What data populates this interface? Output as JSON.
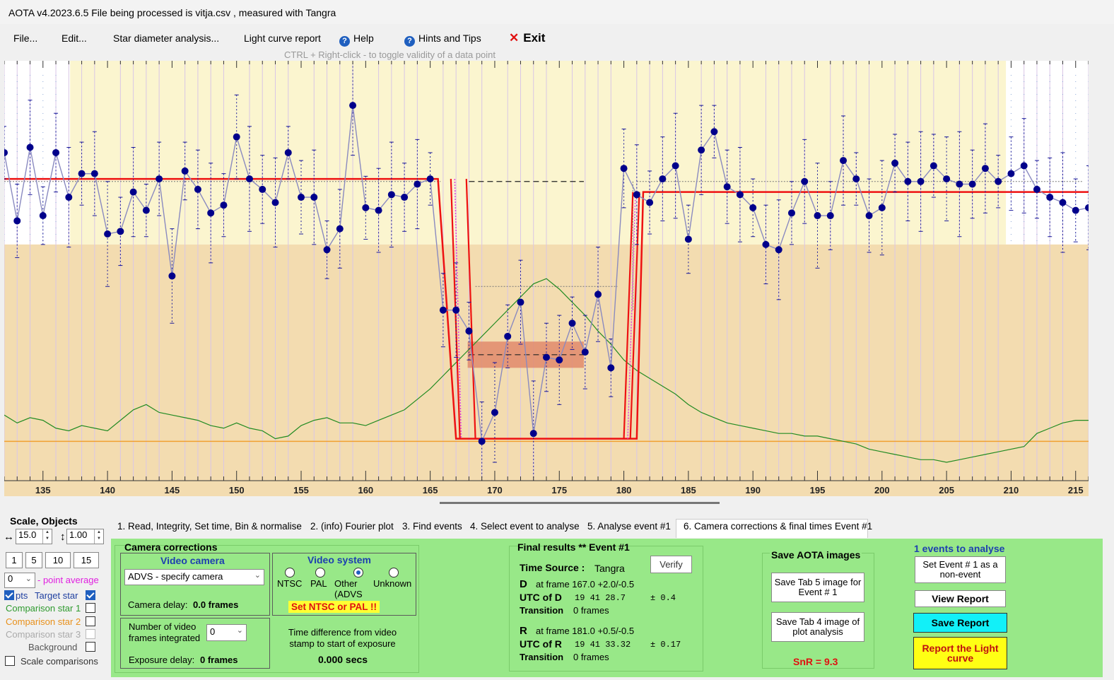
{
  "window": {
    "title": "AOTA v4.2023.6.5    File being processed is  vitja.csv ,  measured with Tangra"
  },
  "menu": {
    "file": "File...",
    "edit": "Edit...",
    "star_diameter": "Star diameter analysis...",
    "light_curve_report": "Light curve report",
    "help": "Help",
    "hints": "Hints and Tips",
    "exit": "Exit",
    "help_icon": "question-circle-icon",
    "exit_icon": "close-x-icon"
  },
  "hint": "CTRL + Right-click   -   to toggle validity of a data point",
  "chart_data": {
    "type": "line",
    "x_ticks": [
      "135",
      "140",
      "145",
      "150",
      "155",
      "160",
      "165",
      "170",
      "175",
      "180",
      "185",
      "190",
      "195",
      "200",
      "205",
      "210",
      "215"
    ],
    "xlim": [
      132,
      216
    ],
    "ylim": [
      -0.15,
      1.45
    ],
    "grid": true,
    "colors": {
      "target": "#00008b",
      "model": "#ee1111",
      "comparison": "#228b22",
      "baseline": "#f0a030",
      "upper_band": "#fbf5cf",
      "lower_band": "#f3dcb0",
      "event_box": "#e08a6c"
    },
    "series": [
      {
        "name": "Target star",
        "x": [
          132,
          133,
          134,
          135,
          136,
          137,
          138,
          139,
          140,
          141,
          142,
          143,
          144,
          145,
          146,
          147,
          148,
          149,
          150,
          151,
          152,
          153,
          154,
          155,
          156,
          157,
          158,
          159,
          160,
          161,
          162,
          163,
          164,
          165,
          166,
          167,
          168,
          169,
          170,
          171,
          172,
          173,
          174,
          175,
          176,
          177,
          178,
          179,
          180,
          181,
          182,
          183,
          184,
          185,
          186,
          187,
          188,
          189,
          190,
          191,
          192,
          193,
          194,
          195,
          196,
          197,
          198,
          199,
          200,
          201,
          202,
          203,
          204,
          205,
          206,
          207,
          208,
          209,
          210,
          211,
          212,
          213,
          214,
          215,
          216
        ],
        "values": [
          1.1,
          0.84,
          1.12,
          0.86,
          1.1,
          0.93,
          1.02,
          1.02,
          0.79,
          0.8,
          0.95,
          0.88,
          1.0,
          0.63,
          1.03,
          0.96,
          0.87,
          0.9,
          1.16,
          1.0,
          0.96,
          0.91,
          1.1,
          0.93,
          0.93,
          0.73,
          0.81,
          1.28,
          0.89,
          0.88,
          0.94,
          0.93,
          0.98,
          1.0,
          0.5,
          0.5,
          0.42,
          0.0,
          0.11,
          0.4,
          0.53,
          0.03,
          0.32,
          0.31,
          0.45,
          0.34,
          0.56,
          0.28,
          1.04,
          0.94,
          0.91,
          1.0,
          1.05,
          0.77,
          1.11,
          1.18,
          0.97,
          0.94,
          0.89,
          0.75,
          0.73,
          0.87,
          0.99,
          0.86,
          0.86,
          1.07,
          1.0,
          0.86,
          0.89,
          1.06,
          0.99,
          0.99,
          1.05,
          1.0,
          0.98,
          0.98,
          1.04,
          0.99,
          1.02,
          1.05,
          0.96,
          0.93,
          0.91,
          0.88,
          0.89
        ]
      },
      {
        "name": "Model",
        "x": [
          132,
          165.6,
          167.0,
          181.0,
          181.5,
          216
        ],
        "values": [
          1.0,
          1.0,
          0.01,
          0.01,
          0.95,
          0.95
        ]
      },
      {
        "name": "Comparison star 1",
        "x": [
          132,
          133,
          134,
          135,
          136,
          137,
          138,
          139,
          140,
          141,
          142,
          143,
          144,
          145,
          146,
          147,
          148,
          149,
          150,
          151,
          152,
          153,
          154,
          155,
          156,
          157,
          158,
          159,
          160,
          161,
          162,
          163,
          164,
          165,
          166,
          167,
          168,
          169,
          170,
          171,
          172,
          173,
          174,
          175,
          176,
          177,
          178,
          179,
          180,
          181,
          182,
          183,
          184,
          185,
          186,
          187,
          188,
          189,
          190,
          191,
          192,
          193,
          194,
          195,
          196,
          197,
          198,
          199,
          200,
          201,
          202,
          203,
          204,
          205,
          206,
          207,
          208,
          209,
          210,
          211,
          212,
          213,
          214,
          215,
          216
        ],
        "values": [
          0.1,
          0.07,
          0.09,
          0.08,
          0.05,
          0.04,
          0.06,
          0.05,
          0.04,
          0.08,
          0.12,
          0.14,
          0.11,
          0.1,
          0.09,
          0.08,
          0.06,
          0.05,
          0.07,
          0.05,
          0.04,
          0.01,
          0.02,
          0.06,
          0.08,
          0.09,
          0.07,
          0.07,
          0.06,
          0.08,
          0.1,
          0.12,
          0.16,
          0.2,
          0.25,
          0.3,
          0.35,
          0.4,
          0.45,
          0.5,
          0.55,
          0.6,
          0.62,
          0.58,
          0.53,
          0.48,
          0.42,
          0.37,
          0.31,
          0.27,
          0.24,
          0.21,
          0.18,
          0.14,
          0.11,
          0.09,
          0.07,
          0.06,
          0.05,
          0.04,
          0.03,
          0.03,
          0.02,
          0.02,
          0.01,
          0.0,
          -0.01,
          -0.03,
          -0.04,
          -0.05,
          -0.06,
          -0.07,
          -0.07,
          -0.08,
          -0.07,
          -0.06,
          -0.05,
          -0.04,
          -0.03,
          -0.02,
          0.03,
          0.05,
          0.07,
          0.08,
          0.08
        ]
      },
      {
        "name": "Comparison star 2",
        "x": [
          132,
          216
        ],
        "values": [
          0.0,
          0.0
        ]
      }
    ]
  },
  "scale_objects": {
    "title": "Scale,  Objects",
    "h_scale": "15.0",
    "v_scale": "1.00",
    "h_scale_icon": "horizontal-arrow-icon",
    "v_scale_icon": "vertical-arrow-icon",
    "presets": [
      "1",
      "5",
      "10",
      "15"
    ],
    "avg_value": "0",
    "avg_label": "- point average",
    "pts_label": "pts",
    "target_label": "Target star",
    "comp1_label": "Comparison star 1",
    "comp2_label": "Comparison star 2",
    "comp3_label": "Comparison star 3",
    "background_label": "Background",
    "scale_comparisons_label": "Scale comparisons"
  },
  "tabs": [
    "1.  Read, Integrity, Set time, Bin & normalise",
    "2. (info)  Fourier plot",
    "3. Find events",
    "4. Select event to analyse",
    "5. Analyse event #1",
    "6. Camera corrections & final times Event #1"
  ],
  "camera": {
    "title": "Camera corrections",
    "video_camera_title": "Video camera",
    "camera_select": "ADVS - specify camera",
    "camera_delay_label": "Camera delay:",
    "camera_delay_value": "0.0 frames",
    "video_system_title": "Video system",
    "ntsc": "NTSC",
    "pal": "PAL",
    "other": "Other (ADVS",
    "unknown": "Unknown",
    "warning": "Set NTSC or PAL !!",
    "frames_integrated_label": "Number of video frames integrated",
    "frames_integrated_value": "0",
    "exposure_delay_label": "Exposure delay:",
    "exposure_delay_value": "0 frames",
    "time_diff_label": "Time difference from video stamp to start of exposure",
    "time_diff_value": "0.000 secs"
  },
  "final": {
    "title": "Final results  **  Event #1",
    "time_source_label": "Time Source :",
    "time_source_value": "Tangra",
    "verify": "Verify",
    "d_label": "D",
    "d_frame": "at frame 167.0  +2.0/-0.5",
    "utc_d_label": "UTC of D",
    "utc_d_value": "19 41 28.7",
    "utc_d_err": "± 0.4",
    "transition_label": "Transition",
    "transition_d": "0 frames",
    "r_label": "R",
    "r_frame": "at frame 181.0  +0.5/-0.5",
    "utc_r_label": "UTC of R",
    "utc_r_value": "19 41 33.32",
    "utc_r_err": "± 0.17",
    "transition_r": "0 frames"
  },
  "save": {
    "title": "Save AOTA images",
    "tab5": "Save Tab 5 image for Event # 1",
    "tab4": "Save Tab 4 image of plot analysis",
    "snr": "SnR = 9.3"
  },
  "events": {
    "title": "1 events to analyse",
    "set_non_event": "Set Event # 1 as a non-event",
    "view_report": "View Report",
    "save_report": "Save Report",
    "report_lc": "Report the Light curve"
  }
}
